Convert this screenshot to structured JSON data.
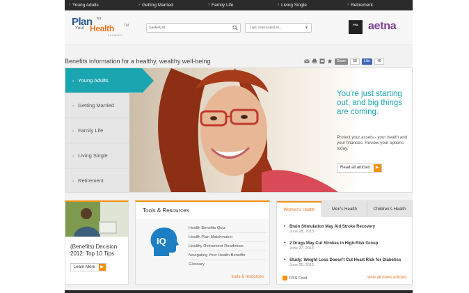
{
  "topnav": {
    "items": [
      "Young Adults",
      "Getting Married",
      "Family Life",
      "Living Single",
      "Retirement"
    ]
  },
  "header": {
    "logo": {
      "plan": "Plan",
      "for": "for",
      "your": "Your",
      "health": "Health",
      "tm": "TM",
      "sub": "ANSWERS"
    },
    "search_placeholder": "SEARCH",
    "interest_label": "I am interested in...",
    "partner1": "FFA",
    "partner2": "aetna"
  },
  "tagline": "Benefits information for a healthy, wealthy well-being",
  "share": {
    "share_label": "Share",
    "share_count": "58",
    "like_label": "Like",
    "like_count": "46"
  },
  "hero": {
    "nav": [
      "Young Adults",
      "Getting Married",
      "Family Life",
      "Living Single",
      "Retirement"
    ],
    "active_index": 0,
    "headline": "You're just starting out, and big things are coming.",
    "subtext": "Protect your assets - your health and your finances. Review your options today.",
    "cta": "Read all articles"
  },
  "card_decision": {
    "title": "(Benefits) Decision 2012: Top 10 Tips",
    "button": "Learn More"
  },
  "card_tools": {
    "heading": "Tools & Resources",
    "iq_label": "IQ",
    "links": [
      "Health Benefits Quiz",
      "Health Plan Matchmaker",
      "Healthy Retirement Readiness",
      "Navigating Your Health Benefits",
      "Glossary"
    ],
    "footer": "tools & resources"
  },
  "card_news": {
    "tabs": [
      "Women's Health",
      "Men's Health",
      "Children's Health"
    ],
    "items": [
      {
        "title": "Brain Stimulation May Aid Stroke Recovery",
        "date": "June 28, 2013"
      },
      {
        "title": "2 Drugs May Cut Strokes in High-Risk Group",
        "date": "June 27, 2013"
      },
      {
        "title": "Study: Weight Loss Doesn't Cut Heart Risk for Diabetics",
        "date": "June 25, 2013"
      }
    ],
    "rss": "RSS Feed",
    "view_all": "view all news articles"
  },
  "colors": {
    "teal": "#1aa5b0",
    "orange": "#f29111",
    "dark": "#2b2b2b",
    "aetna": "#7b3f8f",
    "brand_blue": "#2b5a8f"
  }
}
